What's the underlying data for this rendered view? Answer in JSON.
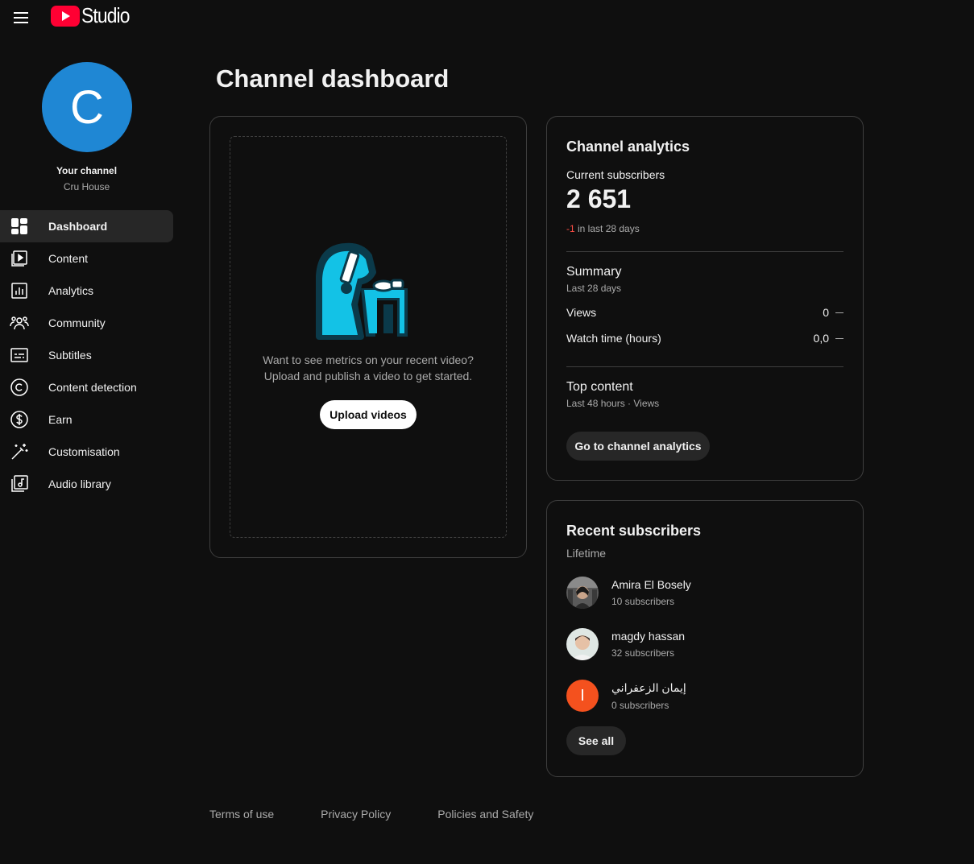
{
  "header": {
    "logo_text": "Studio"
  },
  "sidebar": {
    "avatar_letter": "C",
    "your_channel": "Your channel",
    "channel_name": "Cru House",
    "items": [
      {
        "label": "Dashboard",
        "icon": "dashboard-icon"
      },
      {
        "label": "Content",
        "icon": "content-icon"
      },
      {
        "label": "Analytics",
        "icon": "analytics-icon"
      },
      {
        "label": "Community",
        "icon": "community-icon"
      },
      {
        "label": "Subtitles",
        "icon": "subtitles-icon"
      },
      {
        "label": "Content detection",
        "icon": "copyright-icon"
      },
      {
        "label": "Earn",
        "icon": "dollar-icon"
      },
      {
        "label": "Customisation",
        "icon": "magic-wand-icon"
      },
      {
        "label": "Audio library",
        "icon": "audio-library-icon"
      }
    ]
  },
  "main": {
    "title": "Channel dashboard",
    "video_card": {
      "line1": "Want to see metrics on your recent video?",
      "line2": "Upload and publish a video to get started.",
      "button": "Upload videos"
    },
    "analytics": {
      "title": "Channel analytics",
      "subs_label": "Current subscribers",
      "subs_value": "2 651",
      "change_value": "-1",
      "change_text": " in last 28 days",
      "summary_title": "Summary",
      "summary_sub": "Last 28 days",
      "metrics": [
        {
          "label": "Views",
          "value": "0"
        },
        {
          "label": "Watch time (hours)",
          "value": "0,0"
        }
      ],
      "top_title": "Top content",
      "top_sub": "Last 48 hours · Views",
      "button": "Go to channel analytics"
    },
    "recent_subscribers": {
      "title": "Recent subscribers",
      "period": "Lifetime",
      "items": [
        {
          "name": "Amira El Bosely",
          "count": "10 subscribers"
        },
        {
          "name": "magdy hassan",
          "count": "32 subscribers"
        },
        {
          "name": "إيمان الزعفراني",
          "count": "0 subscribers",
          "letter": "I",
          "color": "#f4511e"
        }
      ],
      "button": "See all"
    }
  },
  "footer": {
    "links": [
      "Terms of use",
      "Privacy Policy",
      "Policies and Safety"
    ]
  }
}
